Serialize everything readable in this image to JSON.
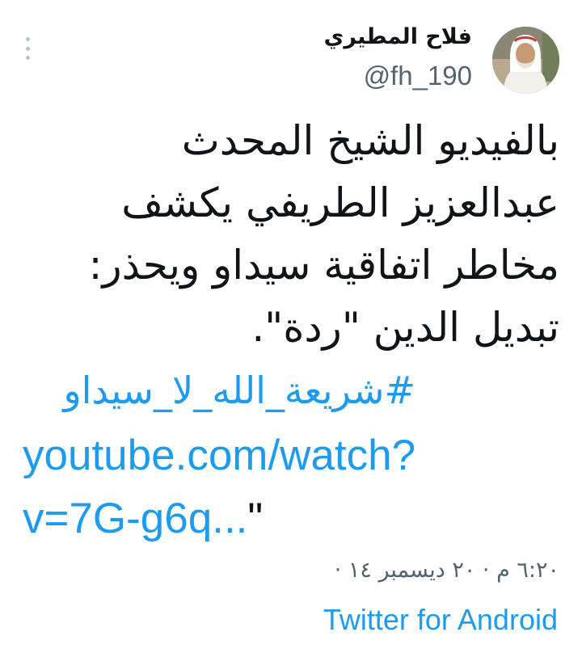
{
  "tweet": {
    "author": {
      "display_name": "فلاح المطيري",
      "handle": "@fh_190"
    },
    "text_lines": [
      "بالفيديو الشيخ المحدث",
      "عبدالعزيز الطريفي يكشف",
      "مخاطر اتفاقية سيداو ويحذر:",
      "تبديل الدين \"ردة\"."
    ],
    "hashtag": "#شريعة_الله_لا_سيداو",
    "link_lines": [
      "youtube.com/watch?",
      "v=7G-g6q..."
    ],
    "closing_quote": "\"",
    "timestamp": "٦:٢٠ م · ٢٠ ديسمبر ١٤ ·",
    "source": "Twitter for Android"
  },
  "icons": {
    "more": "more-vertical-icon"
  },
  "colors": {
    "link": "#1d9bf0",
    "text": "#0f1419",
    "secondary": "#536471"
  }
}
